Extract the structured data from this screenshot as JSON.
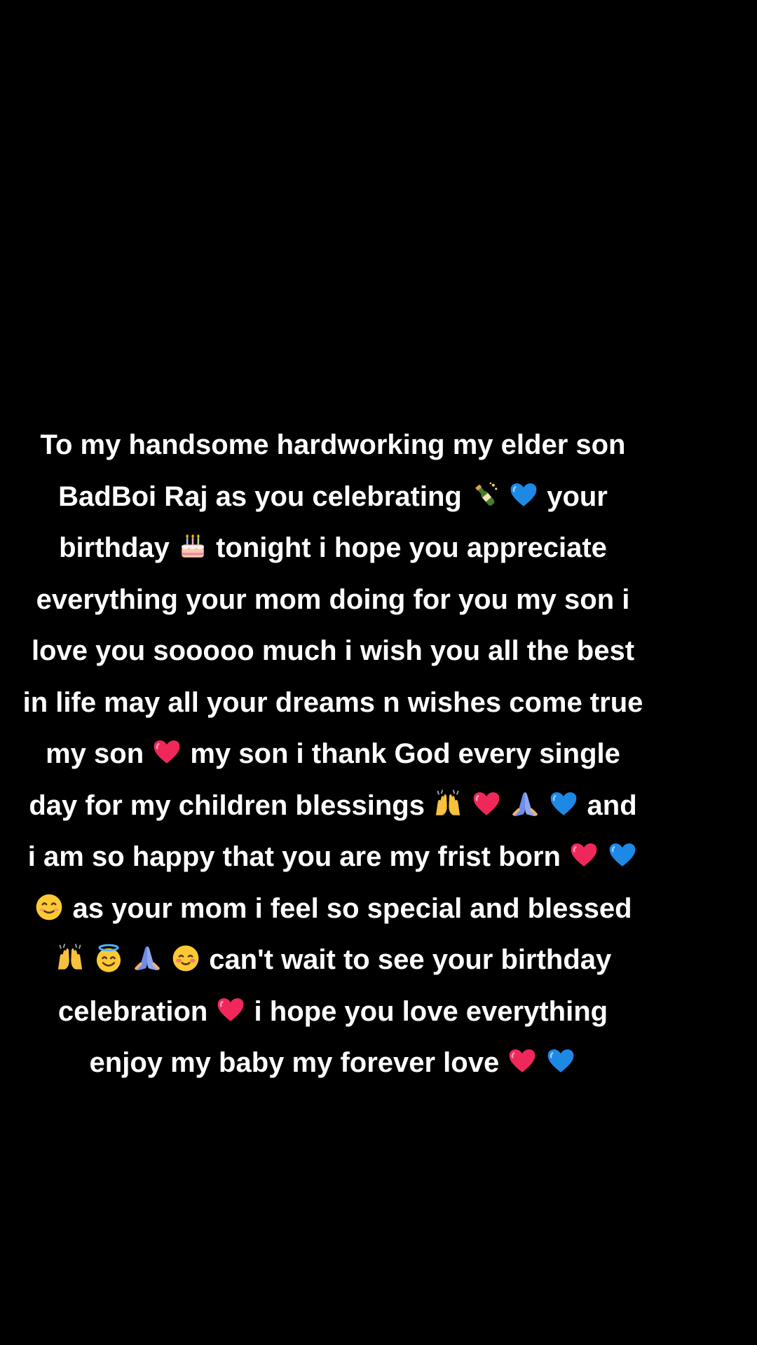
{
  "background_color": "#000000",
  "text_color": "#ffffff",
  "caption": {
    "lines": [
      {
        "segments": [
          {
            "type": "text",
            "text": "To my handsome hardworking my elder son"
          }
        ]
      },
      {
        "segments": [
          {
            "type": "text",
            "text": "BadBoi Raj as you celebrating "
          },
          {
            "type": "emoji",
            "icon": "champagne-bottle-icon"
          },
          {
            "type": "text",
            "text": " "
          },
          {
            "type": "emoji",
            "icon": "blue-heart-icon"
          },
          {
            "type": "text",
            "text": " your"
          }
        ]
      },
      {
        "segments": [
          {
            "type": "text",
            "text": "birthday "
          },
          {
            "type": "emoji",
            "icon": "birthday-cake-icon"
          },
          {
            "type": "text",
            "text": " tonight i hope you appreciate"
          }
        ]
      },
      {
        "segments": [
          {
            "type": "text",
            "text": "everything your mom doing for you my son i"
          }
        ]
      },
      {
        "segments": [
          {
            "type": "text",
            "text": "love you sooooo much i wish you all the best"
          }
        ]
      },
      {
        "segments": [
          {
            "type": "text",
            "text": "in life may all your dreams n wishes come true"
          }
        ]
      },
      {
        "segments": [
          {
            "type": "text",
            "text": "my son "
          },
          {
            "type": "emoji",
            "icon": "pink-heart-icon"
          },
          {
            "type": "text",
            "text": " my son i thank God every single"
          }
        ]
      },
      {
        "segments": [
          {
            "type": "text",
            "text": "day for my children blessings "
          },
          {
            "type": "emoji",
            "icon": "raising-hands-icon"
          },
          {
            "type": "text",
            "text": " "
          },
          {
            "type": "emoji",
            "icon": "pink-heart-icon"
          },
          {
            "type": "text",
            "text": " "
          },
          {
            "type": "emoji",
            "icon": "folded-hands-icon"
          },
          {
            "type": "text",
            "text": " "
          },
          {
            "type": "emoji",
            "icon": "blue-heart-icon"
          },
          {
            "type": "text",
            "text": " and"
          }
        ]
      },
      {
        "segments": [
          {
            "type": "text",
            "text": "i am so happy that you are my frist born "
          },
          {
            "type": "emoji",
            "icon": "pink-heart-icon"
          },
          {
            "type": "text",
            "text": " "
          },
          {
            "type": "emoji",
            "icon": "blue-heart-icon"
          }
        ]
      },
      {
        "segments": [
          {
            "type": "emoji",
            "icon": "smiling-face-icon"
          },
          {
            "type": "text",
            "text": " as your mom i feel so special and blessed"
          }
        ]
      },
      {
        "segments": [
          {
            "type": "emoji",
            "icon": "raising-hands-icon"
          },
          {
            "type": "text",
            "text": " "
          },
          {
            "type": "emoji",
            "icon": "halo-face-icon"
          },
          {
            "type": "text",
            "text": " "
          },
          {
            "type": "emoji",
            "icon": "folded-hands-icon"
          },
          {
            "type": "text",
            "text": " "
          },
          {
            "type": "emoji",
            "icon": "blushing-face-icon"
          },
          {
            "type": "text",
            "text": " can't wait to see your birthday"
          }
        ]
      },
      {
        "segments": [
          {
            "type": "text",
            "text": "celebration "
          },
          {
            "type": "emoji",
            "icon": "pink-heart-icon"
          },
          {
            "type": "text",
            "text": " i hope you love everything"
          }
        ]
      },
      {
        "segments": [
          {
            "type": "text",
            "text": "enjoy my baby my forever love "
          },
          {
            "type": "emoji",
            "icon": "pink-heart-icon"
          },
          {
            "type": "text",
            "text": " "
          },
          {
            "type": "emoji",
            "icon": "blue-heart-icon"
          }
        ]
      }
    ]
  }
}
